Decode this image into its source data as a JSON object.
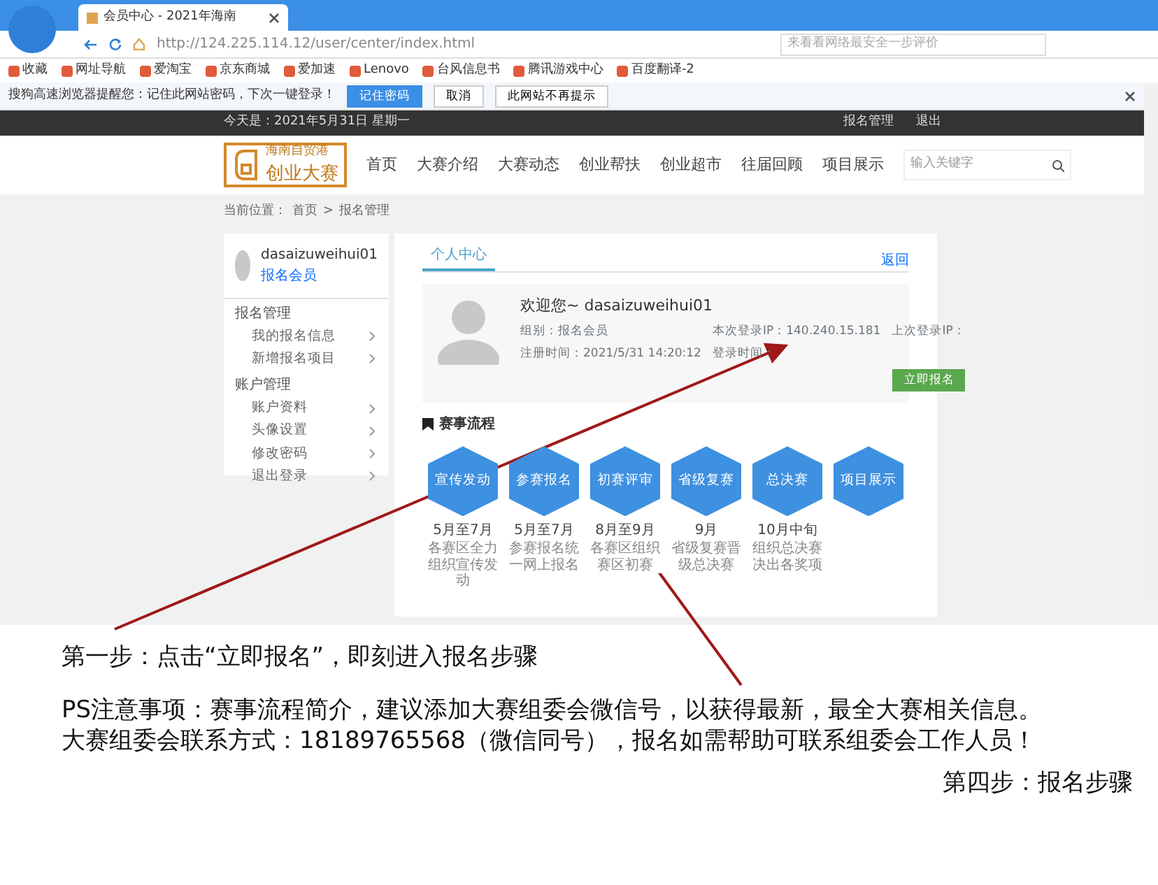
{
  "browser": {
    "tab_title": "会员中心 - 2021年海南",
    "url": "http://124.225.114.12/user/center/index.html",
    "search_placeholder": "来看看网络最安全一步评价",
    "bookmarks": [
      "收藏",
      "网址导航",
      "爱淘宝",
      "京东商城",
      "爱加速",
      "Lenovo",
      "台风信息书",
      "腾讯游戏中心",
      "百度翻译-2"
    ],
    "notice": {
      "text": "搜狗高速浏览器提醒您：记住此网站密码，下次一键登录！",
      "buttons": [
        "记住密码",
        "取消",
        "此网站不再提示"
      ]
    }
  },
  "site": {
    "date": "今天是：2021年5月31日 星期一",
    "top_links": [
      "报名管理",
      "退出"
    ],
    "logo": [
      "海南自贸港",
      "创业大赛"
    ],
    "nav": [
      "首页",
      "大赛介绍",
      "大赛动态",
      "创业帮扶",
      "创业超市",
      "往届回顾",
      "项目展示"
    ],
    "search_placeholder": "输入关键字"
  },
  "breadcrumb": [
    "当前位置：",
    "首页",
    ">",
    "报名管理"
  ],
  "sidebar": {
    "username": "dasaizuweihui01",
    "role": "报名会员",
    "groups": [
      {
        "title": "报名管理",
        "items": [
          "我的报名信息",
          "新增报名项目"
        ]
      },
      {
        "title": "账户管理",
        "items": [
          "账户资料",
          "头像设置",
          "修改密码",
          "退出登录"
        ]
      }
    ]
  },
  "profile": {
    "tab": "个人中心",
    "back": "返回",
    "welcome": "欢迎您~ dasaizuweihui01",
    "fields": [
      "组别：报名会员",
      "本次登录IP：140.240.15.181",
      "上次登录IP：",
      "注册时间：2021/5/31 14:20:12",
      "登录时间："
    ],
    "button": "立即报名"
  },
  "process": {
    "title": "赛事流程",
    "steps": [
      {
        "label": "宣传发动",
        "date": "5月至7月",
        "desc": "各赛区全力组织宣传发动"
      },
      {
        "label": "参赛报名",
        "date": "5月至7月",
        "desc": "参赛报名统一网上报名"
      },
      {
        "label": "初赛评审",
        "date": "8月至9月",
        "desc": "各赛区组织赛区初赛"
      },
      {
        "label": "省级复赛",
        "date": "9月",
        "desc": "省级复赛晋级总决赛"
      },
      {
        "label": "总决赛",
        "date": "10月中旬",
        "desc": "组织总决赛决出各奖项"
      },
      {
        "label": "项目展示"
      }
    ]
  },
  "annotations": {
    "step": "第一步：点击“立即报名”，即刻进入报名步骤",
    "notes": [
      "PS注意事项：赛事流程简介，建议添加大赛组委会微信号，以获得最新，最全大赛相关信息。",
      "大赛组委会联系方式：18189765568（微信同号），报名如需帮助可联系组委会工作人员！"
    ],
    "footer": "第四步：报名步骤"
  }
}
